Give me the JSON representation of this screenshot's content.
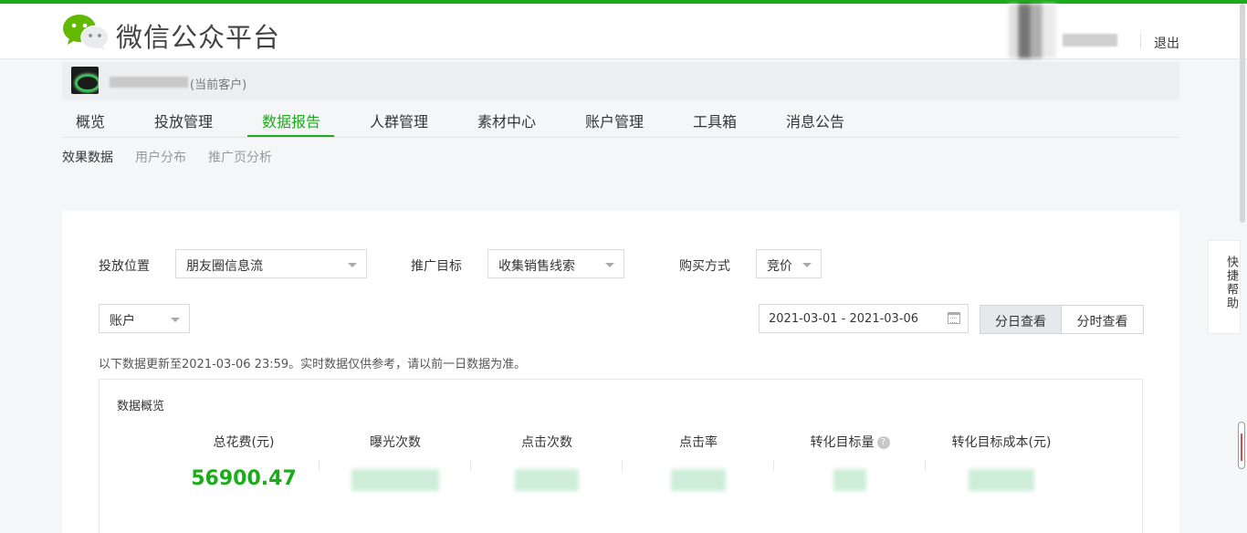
{
  "header": {
    "title": "微信公众平台",
    "logout_label": "退出"
  },
  "account": {
    "current_label": "(当前客户)"
  },
  "main_nav": {
    "items": [
      {
        "label": "概览"
      },
      {
        "label": "投放管理"
      },
      {
        "label": "数据报告",
        "active": true
      },
      {
        "label": "人群管理"
      },
      {
        "label": "素材中心"
      },
      {
        "label": "账户管理"
      },
      {
        "label": "工具箱"
      },
      {
        "label": "消息公告"
      }
    ]
  },
  "sub_nav": {
    "items": [
      {
        "label": "效果数据",
        "active": true
      },
      {
        "label": "用户分布"
      },
      {
        "label": "推广页分析"
      }
    ]
  },
  "filters": {
    "placement_label": "投放位置",
    "placement_value": "朋友圈信息流",
    "goal_label": "推广目标",
    "goal_value": "收集销售线索",
    "buy_label": "购买方式",
    "buy_value": "竞价",
    "level_value": "账户",
    "date_range": "2021-03-01 - 2021-03-06",
    "view_daily": "分日查看",
    "view_hourly": "分时查看"
  },
  "notice": "以下数据更新至2021-03-06 23:59。实时数据仅供参考，请以前一日数据为准。",
  "overview": {
    "title": "数据概览",
    "metrics": [
      {
        "label": "总花费(元)",
        "value": "56900.47"
      },
      {
        "label": "曝光次数"
      },
      {
        "label": "点击次数"
      },
      {
        "label": "点击率"
      },
      {
        "label": "转化目标量"
      },
      {
        "label": "转化目标成本(元)"
      }
    ]
  },
  "side": {
    "quick_help": "快捷帮助"
  },
  "colors": {
    "brand_green": "#1aad19"
  }
}
